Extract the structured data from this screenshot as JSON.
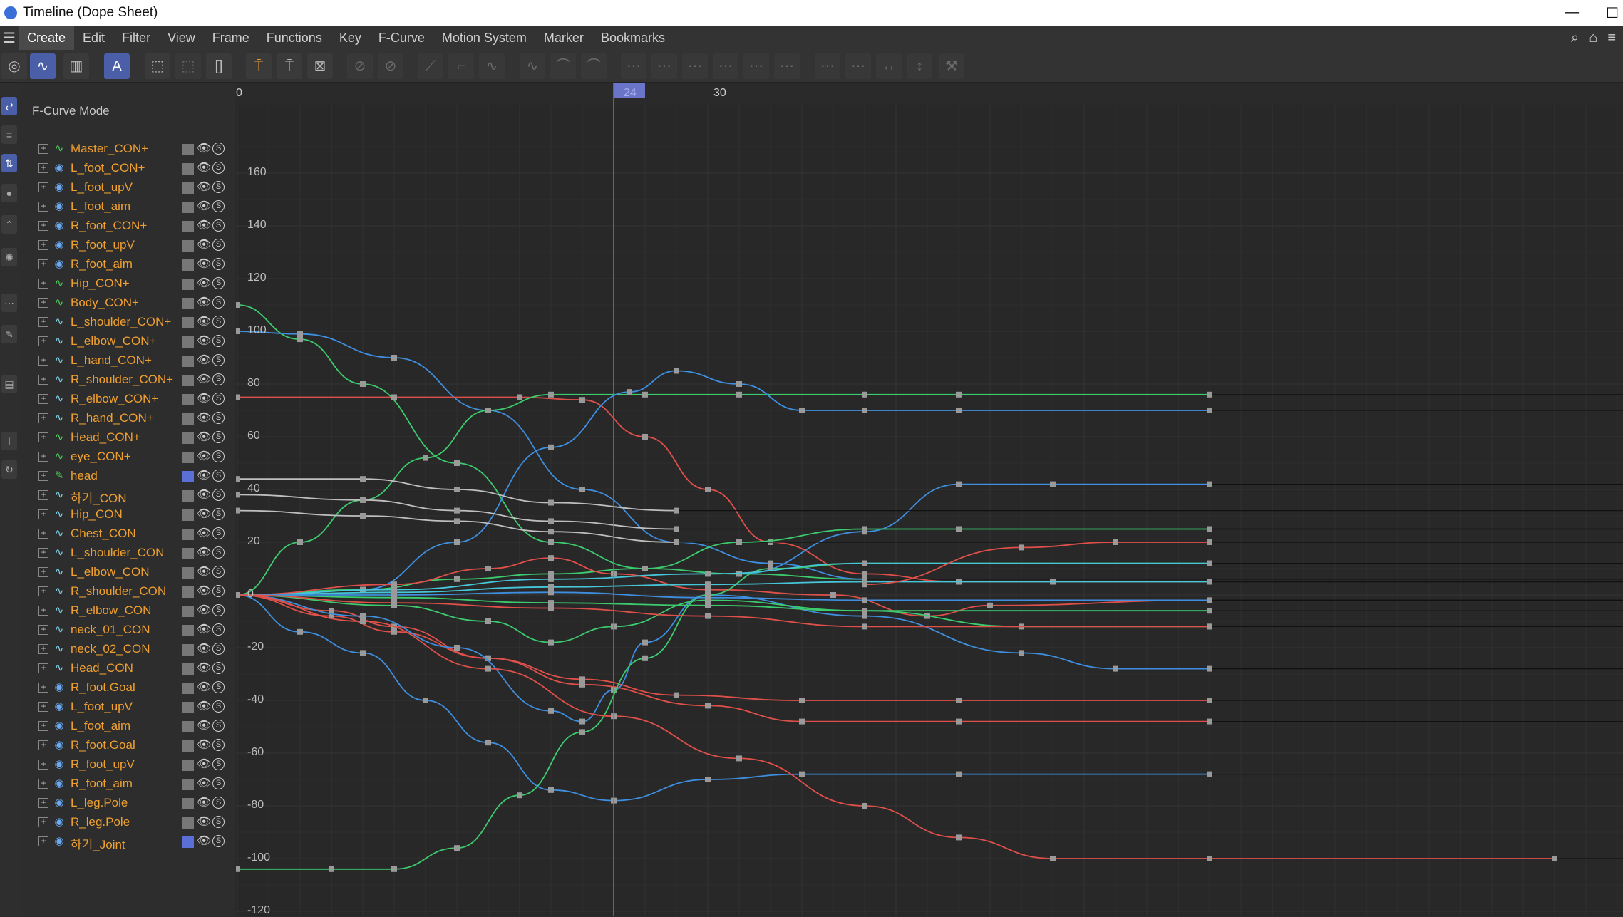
{
  "window": {
    "title": "Timeline (Dope Sheet)",
    "minimize": "—",
    "maximize": "☐"
  },
  "menu": {
    "items": [
      "Create",
      "Edit",
      "Filter",
      "View",
      "Frame",
      "Functions",
      "Key",
      "F-Curve",
      "Motion System",
      "Marker",
      "Bookmarks"
    ],
    "active": "Create"
  },
  "panel": {
    "mode_label": "F-Curve Mode",
    "rows": [
      {
        "label": "Master_CON+",
        "icon": "spline-green"
      },
      {
        "label": "L_foot_CON+",
        "icon": "null-blue"
      },
      {
        "label": "L_foot_upV",
        "icon": "null-blue"
      },
      {
        "label": "L_foot_aim",
        "icon": "null-blue"
      },
      {
        "label": "R_foot_CON+",
        "icon": "null-blue"
      },
      {
        "label": "R_foot_upV",
        "icon": "null-blue"
      },
      {
        "label": "R_foot_aim",
        "icon": "null-blue"
      },
      {
        "label": "Hip_CON+",
        "icon": "spline-green"
      },
      {
        "label": "Body_CON+",
        "icon": "spline-green"
      },
      {
        "label": "L_shoulder_CON+",
        "icon": "spline-cyan"
      },
      {
        "label": "L_elbow_CON+",
        "icon": "spline-cyan"
      },
      {
        "label": "L_hand_CON+",
        "icon": "spline-cyan"
      },
      {
        "label": "R_shoulder_CON+",
        "icon": "spline-cyan"
      },
      {
        "label": "R_elbow_CON+",
        "icon": "spline-cyan"
      },
      {
        "label": "R_hand_CON+",
        "icon": "spline-cyan"
      },
      {
        "label": "Head_CON+",
        "icon": "spline-green"
      },
      {
        "label": "eye_CON+",
        "icon": "spline-green"
      },
      {
        "label": "head",
        "icon": "brush-green",
        "swatch": "blue"
      },
      {
        "label": "하기_CON",
        "icon": "spline-cyan"
      },
      {
        "label": "Hip_CON",
        "icon": "spline-cyan"
      },
      {
        "label": "Chest_CON",
        "icon": "spline-cyan"
      },
      {
        "label": "L_shoulder_CON",
        "icon": "spline-cyan"
      },
      {
        "label": "L_elbow_CON",
        "icon": "spline-cyan"
      },
      {
        "label": "R_shoulder_CON",
        "icon": "spline-cyan"
      },
      {
        "label": "R_elbow_CON",
        "icon": "spline-cyan"
      },
      {
        "label": "neck_01_CON",
        "icon": "spline-cyan"
      },
      {
        "label": "neck_02_CON",
        "icon": "spline-cyan"
      },
      {
        "label": "Head_CON",
        "icon": "spline-cyan"
      },
      {
        "label": "R_foot.Goal",
        "icon": "null-blue"
      },
      {
        "label": "L_foot_upV",
        "icon": "null-blue"
      },
      {
        "label": "L_foot_aim",
        "icon": "null-blue"
      },
      {
        "label": "R_foot.Goal",
        "icon": "null-blue"
      },
      {
        "label": "R_foot_upV",
        "icon": "null-blue"
      },
      {
        "label": "R_foot_aim",
        "icon": "null-blue"
      },
      {
        "label": "L_leg.Pole",
        "icon": "null-blue"
      },
      {
        "label": "R_leg.Pole",
        "icon": "null-blue"
      },
      {
        "label": "하기_Joint",
        "icon": "joint-blue",
        "swatch": "blue"
      }
    ]
  },
  "graph": {
    "y_ticks": [
      "160",
      "140",
      "120",
      "100",
      "80",
      "60",
      "40",
      "20",
      "0",
      "-20",
      "-40",
      "-60",
      "-80",
      "-100",
      "-120"
    ],
    "x_ticks": [
      "24",
      "30"
    ],
    "x_first_label": "0",
    "current_frame": 24,
    "colors": {
      "red": "#e0504a",
      "green": "#3ccc6e",
      "blue": "#3f8fe0",
      "cyan": "#46c6d8",
      "white": "#bfbfbf",
      "playhead": "#6a74c8"
    }
  }
}
